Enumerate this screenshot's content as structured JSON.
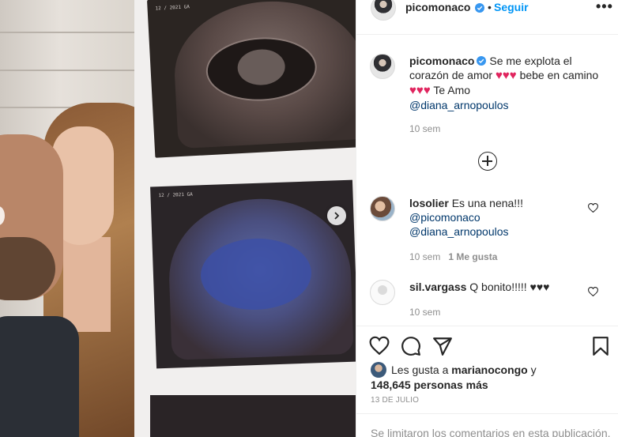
{
  "post": {
    "username": "picomonaco",
    "follow_label": "Seguir",
    "separator": "•",
    "more_label": "•••"
  },
  "caption": {
    "username": "picomonaco",
    "text_1": "Se me explota el corazón de amor",
    "hearts_1": "♥♥♥",
    "text_2": "bebe en camino",
    "hearts_2": "♥♥♥",
    "text_3": "Te Amo",
    "mention": "@diana_arnopoulos",
    "time": "10 sem"
  },
  "comments": [
    {
      "username": "losolier",
      "text": "Es una nena!!!",
      "mention_1": "@picomonaco",
      "mention_2": "@diana_arnopoulos",
      "time": "10 sem",
      "likes": "1 Me gusta"
    },
    {
      "username": "sil.vargass",
      "text": "Q bonito!!!!!",
      "hearts": "♥♥♥",
      "time": "10 sem"
    }
  ],
  "likes": {
    "prefix": "Les gusta a",
    "user": "marianocongo",
    "connector": "y",
    "count": "148,645 personas más"
  },
  "date": "13 DE JULIO",
  "footer_text": "Se limitaron los comentarios en esta publicación.",
  "ultrasound": {
    "label_1": "12 / 2021  GA",
    "label_2": "12 / 2021  GA"
  },
  "colors": {
    "accent": "#0095f6",
    "heart": "#e0245e",
    "mention": "#00376b",
    "muted": "#8e8e8e"
  },
  "icons": [
    "verified-badge-icon",
    "more-options-icon",
    "add-comment-icon",
    "like-icon",
    "comment-icon",
    "share-icon",
    "save-icon",
    "chevron-right-icon"
  ]
}
